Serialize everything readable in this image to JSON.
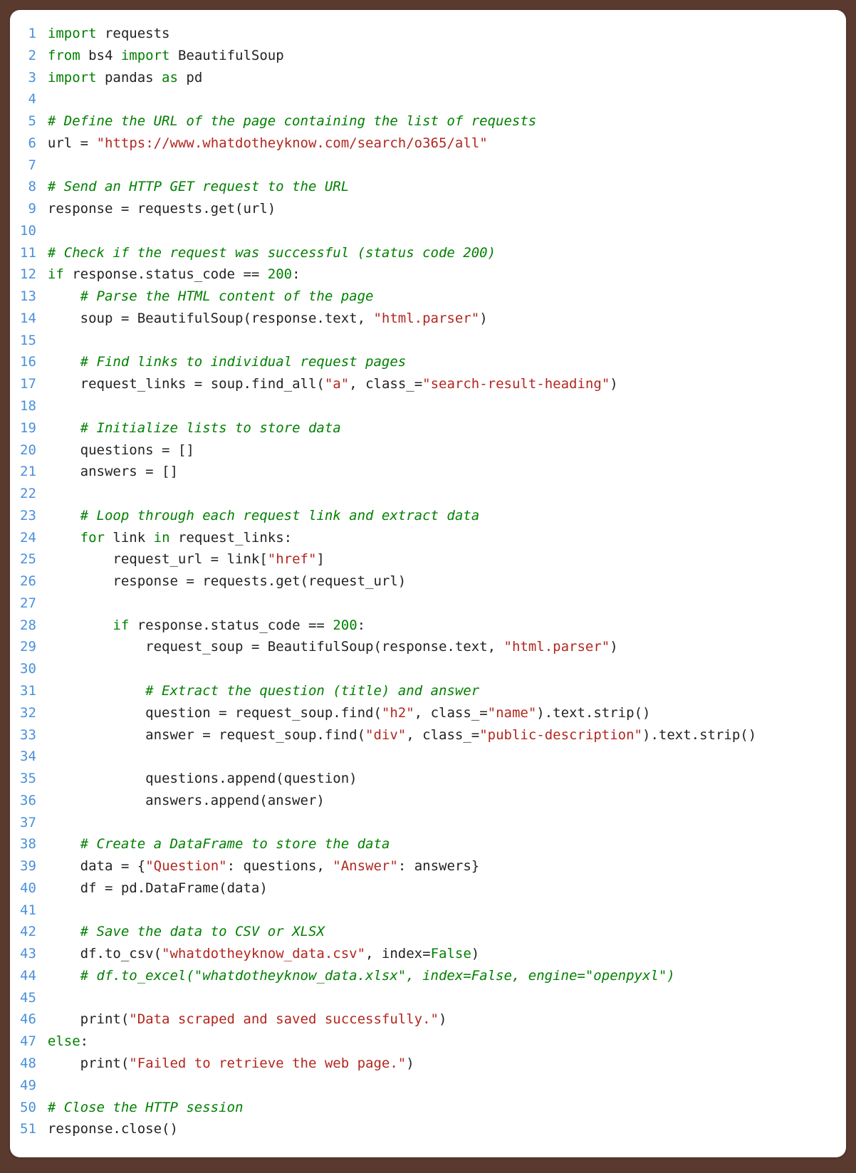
{
  "code": {
    "language": "python",
    "lines": [
      [
        [
          "kw",
          "import"
        ],
        [
          "id",
          " requests"
        ]
      ],
      [
        [
          "kw",
          "from"
        ],
        [
          "id",
          " bs4 "
        ],
        [
          "kw",
          "import"
        ],
        [
          "id",
          " BeautifulSoup"
        ]
      ],
      [
        [
          "kw",
          "import"
        ],
        [
          "id",
          " pandas "
        ],
        [
          "kw",
          "as"
        ],
        [
          "id",
          " pd"
        ]
      ],
      [
        [
          "id",
          ""
        ]
      ],
      [
        [
          "cm",
          "# Define the URL of the page containing the list of requests"
        ]
      ],
      [
        [
          "id",
          "url "
        ],
        [
          "op",
          "="
        ],
        [
          "id",
          " "
        ],
        [
          "str",
          "\"https://www.whatdotheyknow.com/search/o365/all\""
        ]
      ],
      [
        [
          "id",
          ""
        ]
      ],
      [
        [
          "cm",
          "# Send an HTTP GET request to the URL"
        ]
      ],
      [
        [
          "id",
          "response "
        ],
        [
          "op",
          "="
        ],
        [
          "id",
          " requests.get(url)"
        ]
      ],
      [
        [
          "id",
          ""
        ]
      ],
      [
        [
          "cm",
          "# Check if the request was successful (status code 200)"
        ]
      ],
      [
        [
          "kw",
          "if"
        ],
        [
          "id",
          " response.status_code "
        ],
        [
          "op",
          "=="
        ],
        [
          "id",
          " "
        ],
        [
          "num",
          "200"
        ],
        [
          "op",
          ":"
        ]
      ],
      [
        [
          "id",
          "    "
        ],
        [
          "cm",
          "# Parse the HTML content of the page"
        ]
      ],
      [
        [
          "id",
          "    soup "
        ],
        [
          "op",
          "="
        ],
        [
          "id",
          " BeautifulSoup(response.text, "
        ],
        [
          "str",
          "\"html.parser\""
        ],
        [
          "id",
          ")"
        ]
      ],
      [
        [
          "id",
          ""
        ]
      ],
      [
        [
          "id",
          "    "
        ],
        [
          "cm",
          "# Find links to individual request pages"
        ]
      ],
      [
        [
          "id",
          "    request_links "
        ],
        [
          "op",
          "="
        ],
        [
          "id",
          " soup.find_all("
        ],
        [
          "str",
          "\"a\""
        ],
        [
          "id",
          ", "
        ],
        [
          "kwarg",
          "class_"
        ],
        [
          "op",
          "="
        ],
        [
          "str",
          "\"search-result-heading\""
        ],
        [
          "id",
          ")"
        ]
      ],
      [
        [
          "id",
          ""
        ]
      ],
      [
        [
          "id",
          "    "
        ],
        [
          "cm",
          "# Initialize lists to store data"
        ]
      ],
      [
        [
          "id",
          "    questions "
        ],
        [
          "op",
          "="
        ],
        [
          "id",
          " []"
        ]
      ],
      [
        [
          "id",
          "    answers "
        ],
        [
          "op",
          "="
        ],
        [
          "id",
          " []"
        ]
      ],
      [
        [
          "id",
          ""
        ]
      ],
      [
        [
          "id",
          "    "
        ],
        [
          "cm",
          "# Loop through each request link and extract data"
        ]
      ],
      [
        [
          "id",
          "    "
        ],
        [
          "kw",
          "for"
        ],
        [
          "id",
          " link "
        ],
        [
          "kw",
          "in"
        ],
        [
          "id",
          " request_links"
        ],
        [
          "op",
          ":"
        ]
      ],
      [
        [
          "id",
          "        request_url "
        ],
        [
          "op",
          "="
        ],
        [
          "id",
          " link["
        ],
        [
          "str",
          "\"href\""
        ],
        [
          "id",
          "]"
        ]
      ],
      [
        [
          "id",
          "        response "
        ],
        [
          "op",
          "="
        ],
        [
          "id",
          " requests.get(request_url)"
        ]
      ],
      [
        [
          "id",
          ""
        ]
      ],
      [
        [
          "id",
          "        "
        ],
        [
          "kw",
          "if"
        ],
        [
          "id",
          " response.status_code "
        ],
        [
          "op",
          "=="
        ],
        [
          "id",
          " "
        ],
        [
          "num",
          "200"
        ],
        [
          "op",
          ":"
        ]
      ],
      [
        [
          "id",
          "            request_soup "
        ],
        [
          "op",
          "="
        ],
        [
          "id",
          " BeautifulSoup(response.text, "
        ],
        [
          "str",
          "\"html.parser\""
        ],
        [
          "id",
          ")"
        ]
      ],
      [
        [
          "id",
          ""
        ]
      ],
      [
        [
          "id",
          "            "
        ],
        [
          "cm",
          "# Extract the question (title) and answer"
        ]
      ],
      [
        [
          "id",
          "            question "
        ],
        [
          "op",
          "="
        ],
        [
          "id",
          " request_soup.find("
        ],
        [
          "str",
          "\"h2\""
        ],
        [
          "id",
          ", "
        ],
        [
          "kwarg",
          "class_"
        ],
        [
          "op",
          "="
        ],
        [
          "str",
          "\"name\""
        ],
        [
          "id",
          ").text.strip()"
        ]
      ],
      [
        [
          "id",
          "            answer "
        ],
        [
          "op",
          "="
        ],
        [
          "id",
          " request_soup.find("
        ],
        [
          "str",
          "\"div\""
        ],
        [
          "id",
          ", "
        ],
        [
          "kwarg",
          "class_"
        ],
        [
          "op",
          "="
        ],
        [
          "str",
          "\"public-description\""
        ],
        [
          "id",
          ").text.strip()"
        ]
      ],
      [
        [
          "id",
          ""
        ]
      ],
      [
        [
          "id",
          "            questions.append(question)"
        ]
      ],
      [
        [
          "id",
          "            answers.append(answer)"
        ]
      ],
      [
        [
          "id",
          ""
        ]
      ],
      [
        [
          "id",
          "    "
        ],
        [
          "cm",
          "# Create a DataFrame to store the data"
        ]
      ],
      [
        [
          "id",
          "    data "
        ],
        [
          "op",
          "="
        ],
        [
          "id",
          " {"
        ],
        [
          "str",
          "\"Question\""
        ],
        [
          "id",
          ": questions, "
        ],
        [
          "str",
          "\"Answer\""
        ],
        [
          "id",
          ": answers}"
        ]
      ],
      [
        [
          "id",
          "    df "
        ],
        [
          "op",
          "="
        ],
        [
          "id",
          " pd.DataFrame(data)"
        ]
      ],
      [
        [
          "id",
          ""
        ]
      ],
      [
        [
          "id",
          "    "
        ],
        [
          "cm",
          "# Save the data to CSV or XLSX"
        ]
      ],
      [
        [
          "id",
          "    df.to_csv("
        ],
        [
          "str",
          "\"whatdotheyknow_data.csv\""
        ],
        [
          "id",
          ", "
        ],
        [
          "kwarg",
          "index"
        ],
        [
          "op",
          "="
        ],
        [
          "bool",
          "False"
        ],
        [
          "id",
          ")"
        ]
      ],
      [
        [
          "id",
          "    "
        ],
        [
          "cm",
          "# df.to_excel(\"whatdotheyknow_data.xlsx\", index=False, engine=\"openpyxl\")"
        ]
      ],
      [
        [
          "id",
          ""
        ]
      ],
      [
        [
          "id",
          "    print("
        ],
        [
          "str",
          "\"Data scraped and saved successfully.\""
        ],
        [
          "id",
          ")"
        ]
      ],
      [
        [
          "kw",
          "else"
        ],
        [
          "op",
          ":"
        ]
      ],
      [
        [
          "id",
          "    print("
        ],
        [
          "str",
          "\"Failed to retrieve the web page.\""
        ],
        [
          "id",
          ")"
        ]
      ],
      [
        [
          "id",
          ""
        ]
      ],
      [
        [
          "cm",
          "# Close the HTTP session"
        ]
      ],
      [
        [
          "id",
          "response.close()"
        ]
      ]
    ]
  }
}
